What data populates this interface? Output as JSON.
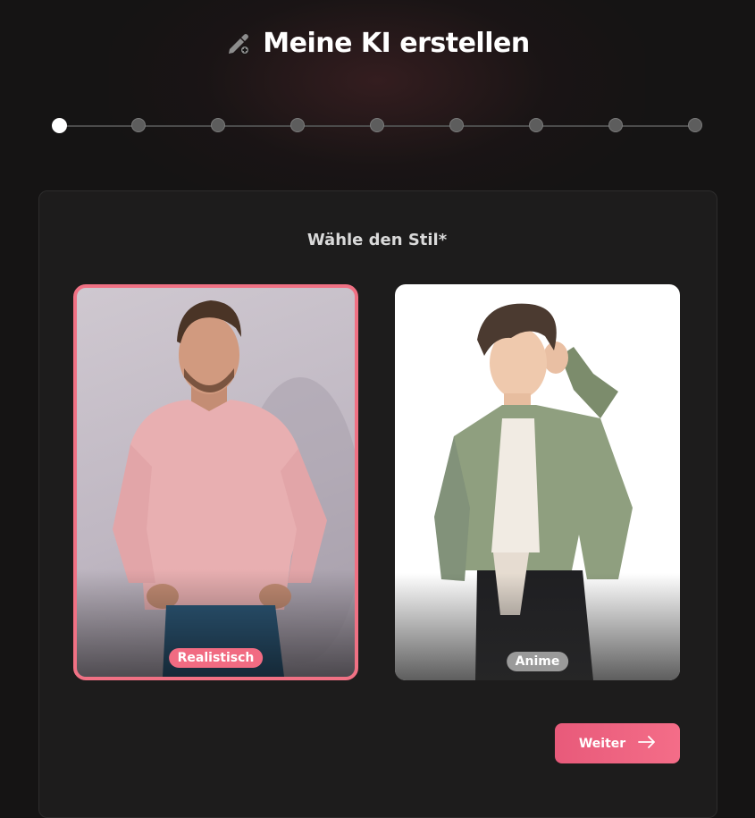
{
  "header": {
    "title": "Meine KI erstellen",
    "icon": "pencil-plus-icon"
  },
  "stepper": {
    "total_steps": 9,
    "current_step": 1
  },
  "section": {
    "title": "Wähle den Stil*"
  },
  "options": [
    {
      "label": "Realistisch",
      "selected": true
    },
    {
      "label": "Anime",
      "selected": false
    }
  ],
  "actions": {
    "next_label": "Weiter",
    "next_icon": "arrow-right-icon"
  },
  "colors": {
    "accent": "#f07184",
    "background": "#151414",
    "card": "#1d1c1c"
  }
}
